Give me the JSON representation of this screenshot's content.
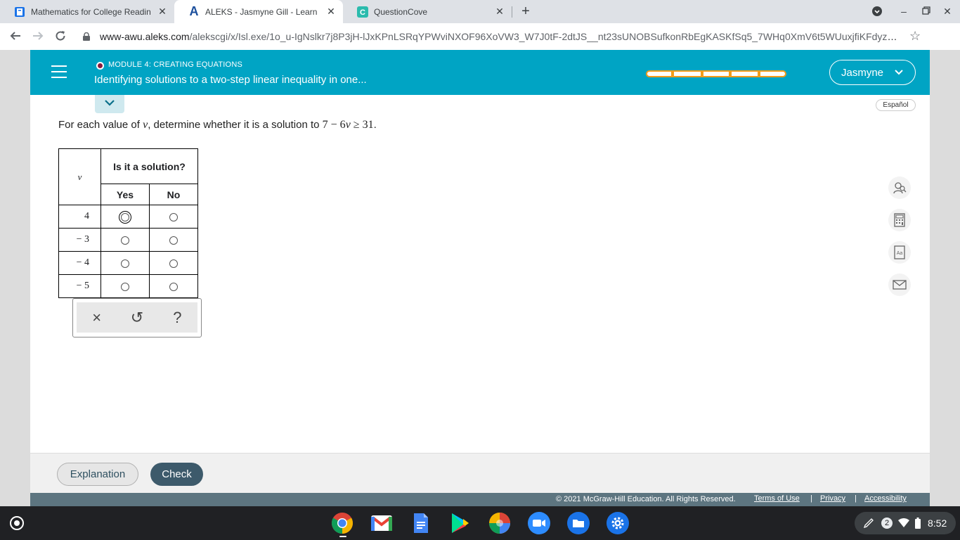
{
  "browser": {
    "tabs": [
      {
        "title": "Mathematics for College Readin",
        "icon": "book-icon",
        "active": false
      },
      {
        "title": "ALEKS - Jasmyne Gill - Learn",
        "icon": "aleks-logo-icon",
        "active": true
      },
      {
        "title": "QuestionCove",
        "icon": "questioncove-icon",
        "active": false
      }
    ],
    "url_host": "www-awu.aleks.com",
    "url_path": "/alekscgi/x/Isl.exe/1o_u-IgNslkr7j8P3jH-lJxKPnLSRqYPWviNXOF96XoVW3_W7J0tF-2dtJS__nt23sUNOBSufkonRbEgKASKfSq5_7WHq0XmV6t5WUuxjfiKFdyzxL..."
  },
  "header": {
    "module_label": "MODULE 4: CREATING EQUATIONS",
    "topic_title": "Identifying solutions to a two-step linear inequality in one...",
    "user_name": "Jasmyne",
    "accent_color": "#00a4c4",
    "progress_color": "#f39c1b"
  },
  "espanol_label": "Español",
  "question": {
    "prefix": "For each value of ",
    "variable": "v",
    "middle": ", determine whether it is a solution to ",
    "inequality_a": "7 − 6",
    "inequality_var": "v",
    "inequality_b": " ≥ 31",
    "suffix": "."
  },
  "table": {
    "var_header": "v",
    "question_header": "Is it a solution?",
    "yes_label": "Yes",
    "no_label": "No",
    "rows": [
      "4",
      "− 3",
      "− 4",
      "− 5"
    ]
  },
  "toolbox": {
    "clear": "×",
    "undo": "↺",
    "help": "?"
  },
  "buttons": {
    "explanation": "Explanation",
    "check": "Check"
  },
  "footer": {
    "copyright": "© 2021 McGraw-Hill Education. All Rights Reserved.",
    "terms": "Terms of Use",
    "privacy": "Privacy",
    "accessibility": "Accessibility",
    "separator": "|"
  },
  "shelf": {
    "notification_count": "2",
    "time": "8:52"
  }
}
